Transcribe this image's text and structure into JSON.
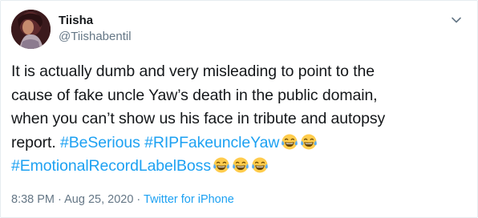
{
  "tweet": {
    "display_name": "Tiisha",
    "handle": "@Tiishabentil",
    "text_line_1": "It is actually dumb and very misleading to point to the",
    "text_line_2": "cause of fake uncle Yaw’s death in the public domain,",
    "text_line_3": "when you can’t show us his face in tribute and autopsy",
    "text_line_4_prefix": "report. ",
    "hashtags": [
      "#BeSerious",
      "#RIPFakeuncleYaw",
      "#EmotionalRecordLabelBoss"
    ],
    "emoji": "face-with-tears-of-joy-icon",
    "time": "8:38 PM",
    "separator": "·",
    "date": "Aug 25, 2020",
    "source": "Twitter for iPhone"
  },
  "colors": {
    "link": "#1da1f2",
    "secondary_text": "#657786",
    "primary_text": "#14171a",
    "border": "#e6ecf0"
  }
}
